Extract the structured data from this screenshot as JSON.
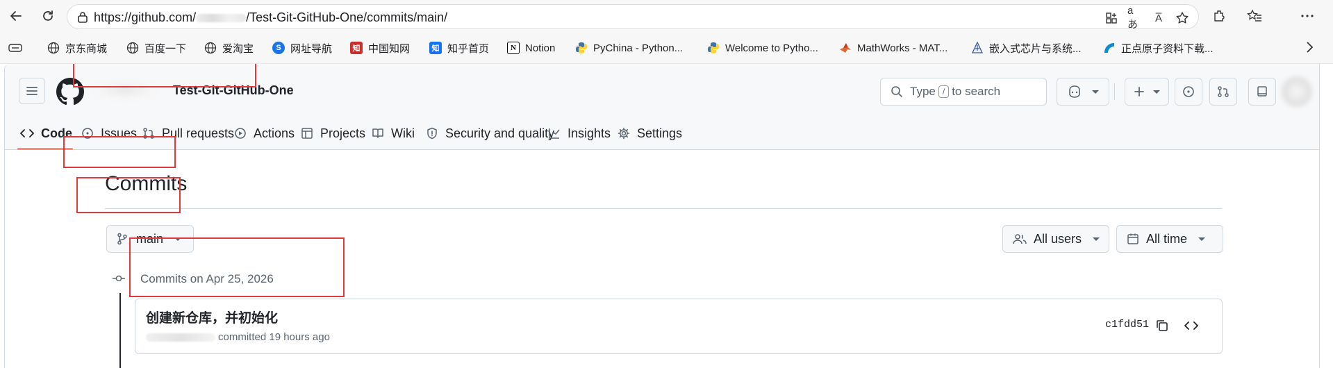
{
  "browser": {
    "url_prefix": "https://github.com/",
    "url_suffix": "/Test-Git-GitHub-One/commits/main/",
    "translate_icon": "aあ",
    "read_aloud_icon": "A̅",
    "bookmarks": [
      {
        "label": "京东商城",
        "icon": "globe-icon"
      },
      {
        "label": "百度一下",
        "icon": "globe-icon"
      },
      {
        "label": "爱淘宝",
        "icon": "globe-icon"
      },
      {
        "label": "网址导航",
        "icon": "sogou-icon"
      },
      {
        "label": "中国知网",
        "icon": "cnki-icon"
      },
      {
        "label": "知乎首页",
        "icon": "zhihu-icon",
        "glyph": "知"
      },
      {
        "label": "Notion",
        "icon": "notion-icon",
        "glyph": "N"
      },
      {
        "label": "PyChina - Python...",
        "icon": "python-icon"
      },
      {
        "label": "Welcome to Pytho...",
        "icon": "python-icon"
      },
      {
        "label": "MathWorks - MAT...",
        "icon": "matlab-icon"
      },
      {
        "label": "嵌入式芯片与系统...",
        "icon": "chip-icon"
      },
      {
        "label": "正点原子资料下载...",
        "icon": "alientek-icon"
      }
    ]
  },
  "github": {
    "repo_name": "Test-Git-GitHub-One",
    "search_prefix": "Type",
    "search_key": "/",
    "search_suffix": "to search",
    "tabs": [
      {
        "label": "Code",
        "icon": "code-icon",
        "active": true
      },
      {
        "label": "Issues",
        "icon": "issue-icon"
      },
      {
        "label": "Pull requests",
        "icon": "pull-request-icon"
      },
      {
        "label": "Actions",
        "icon": "play-icon"
      },
      {
        "label": "Projects",
        "icon": "table-icon"
      },
      {
        "label": "Wiki",
        "icon": "book-icon"
      },
      {
        "label": "Security and quality",
        "icon": "shield-icon"
      },
      {
        "label": "Insights",
        "icon": "graph-icon"
      },
      {
        "label": "Settings",
        "icon": "gear-icon"
      }
    ],
    "accent_color": "#fd8c73",
    "highlight_color": "#e0393e"
  },
  "commits_page": {
    "title": "Commits",
    "branch": "main",
    "users_filter": "All users",
    "time_filter": "All time",
    "group_label": "Commits on Apr 25, 2026",
    "commit": {
      "message": "创建新仓库，并初始化",
      "action": "committed 19 hours ago",
      "sha": "c1fdd51"
    }
  }
}
